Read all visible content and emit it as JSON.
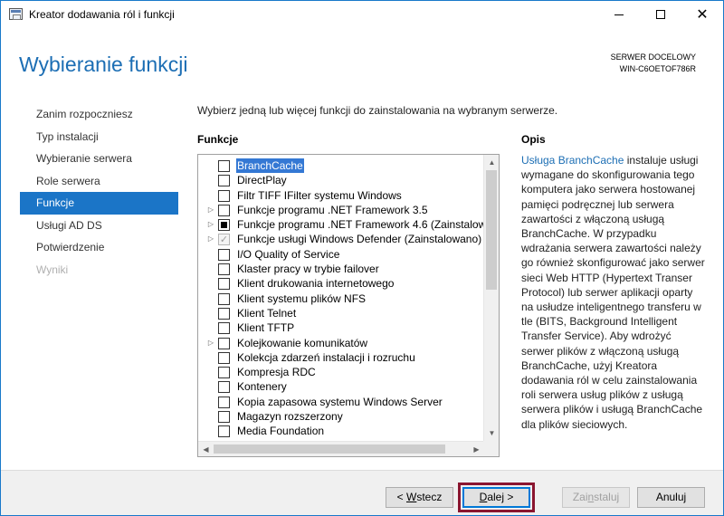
{
  "window": {
    "title": "Kreator dodawania ról i funkcji",
    "controls": {
      "minimize": "minimize",
      "maximize": "maximize",
      "close": "✕"
    }
  },
  "header": {
    "page_title": "Wybieranie funkcji",
    "server_label": "SERWER DOCELOWY",
    "server_name": "WIN-C6OETOF786R"
  },
  "nav": {
    "items": [
      {
        "label": "Zanim rozpoczniesz",
        "state": "normal"
      },
      {
        "label": "Typ instalacji",
        "state": "normal"
      },
      {
        "label": "Wybieranie serwera",
        "state": "normal"
      },
      {
        "label": "Role serwera",
        "state": "normal"
      },
      {
        "label": "Funkcje",
        "state": "active"
      },
      {
        "label": "Usługi AD DS",
        "state": "normal"
      },
      {
        "label": "Potwierdzenie",
        "state": "normal"
      },
      {
        "label": "Wyniki",
        "state": "disabled"
      }
    ]
  },
  "main": {
    "intro": "Wybierz jedną lub więcej funkcji do zainstalowania na wybranym serwerze.",
    "features_heading": "Funkcje",
    "features": [
      {
        "label": "BranchCache",
        "expandable": false,
        "state": "unchecked",
        "selected": true
      },
      {
        "label": "DirectPlay",
        "expandable": false,
        "state": "unchecked"
      },
      {
        "label": "Filtr TIFF IFilter systemu Windows",
        "expandable": false,
        "state": "unchecked"
      },
      {
        "label": "Funkcje programu .NET Framework 3.5",
        "expandable": true,
        "state": "unchecked"
      },
      {
        "label": "Funkcje programu .NET Framework 4.6 (Zainstalow",
        "expandable": true,
        "state": "partial"
      },
      {
        "label": "Funkcje usługi Windows Defender (Zainstalowano)",
        "expandable": true,
        "state": "checked-disabled"
      },
      {
        "label": "I/O Quality of Service",
        "expandable": false,
        "state": "unchecked"
      },
      {
        "label": "Klaster pracy w trybie failover",
        "expandable": false,
        "state": "unchecked"
      },
      {
        "label": "Klient drukowania internetowego",
        "expandable": false,
        "state": "unchecked"
      },
      {
        "label": "Klient systemu plików NFS",
        "expandable": false,
        "state": "unchecked"
      },
      {
        "label": "Klient Telnet",
        "expandable": false,
        "state": "unchecked"
      },
      {
        "label": "Klient TFTP",
        "expandable": false,
        "state": "unchecked"
      },
      {
        "label": "Kolejkowanie komunikatów",
        "expandable": true,
        "state": "unchecked"
      },
      {
        "label": "Kolekcja zdarzeń instalacji i rozruchu",
        "expandable": false,
        "state": "unchecked"
      },
      {
        "label": "Kompresja RDC",
        "expandable": false,
        "state": "unchecked"
      },
      {
        "label": "Kontenery",
        "expandable": false,
        "state": "unchecked"
      },
      {
        "label": "Kopia zapasowa systemu Windows Server",
        "expandable": false,
        "state": "unchecked"
      },
      {
        "label": "Magazyn rozszerzony",
        "expandable": false,
        "state": "unchecked"
      },
      {
        "label": "Media Foundation",
        "expandable": false,
        "state": "unchecked"
      }
    ],
    "description_heading": "Opis",
    "description_link": "Usługa BranchCache",
    "description_text": " instaluje usługi wymagane do skonfigurowania tego komputera jako serwera hostowanej pamięci podręcznej lub serwera zawartości z włączoną usługą BranchCache. W przypadku wdrażania serwera zawartości należy go również skonfigurować jako serwer sieci Web HTTP (Hypertext Transer Protocol) lub serwer aplikacji oparty na usłudze inteligentnego transferu w tle (BITS, Background Intelligent Transfer Service). Aby wdrożyć serwer plików z włączoną usługą BranchCache, użyj Kreatora dodawania ról w celu zainstalowania roli serwera usług plików z usługą serwera plików i usługą BranchCache dla plików sieciowych."
  },
  "footer": {
    "back": {
      "pre": "< ",
      "key": "W",
      "post": "stecz"
    },
    "next": {
      "pre": "",
      "key": "D",
      "post": "alej >"
    },
    "install": {
      "pre": "Zai",
      "key": "n",
      "post": "staluj"
    },
    "cancel": "Anuluj"
  },
  "colors": {
    "accent": "#1b75c7",
    "title": "#1c6eb4",
    "highlight_frame": "#8a1630"
  }
}
